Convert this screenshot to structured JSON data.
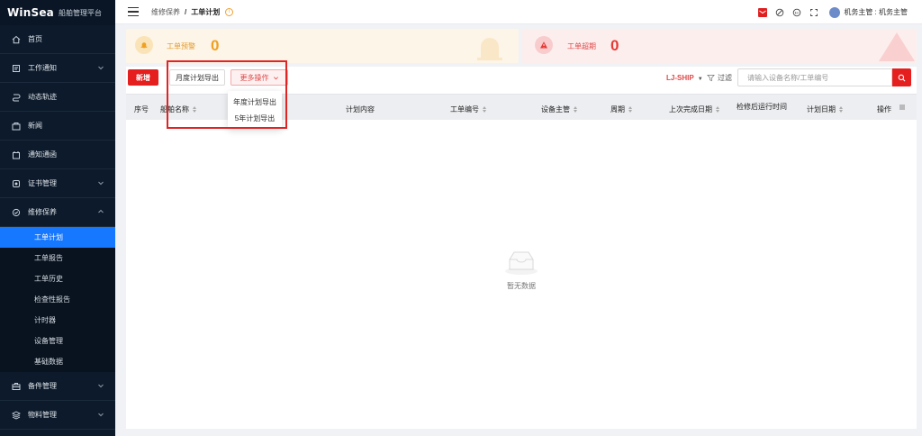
{
  "brand": {
    "logo": "WinSea",
    "subtitle": "船舶管理平台"
  },
  "sidebar": {
    "items": [
      {
        "label": "首页",
        "icon": "home-icon",
        "expandable": false
      },
      {
        "label": "工作通知",
        "icon": "notice-icon",
        "expandable": true
      },
      {
        "label": "动态轨迹",
        "icon": "track-icon",
        "expandable": false
      },
      {
        "label": "新闻",
        "icon": "news-icon",
        "expandable": false
      },
      {
        "label": "通知通函",
        "icon": "circular-icon",
        "expandable": false
      },
      {
        "label": "证书管理",
        "icon": "certificate-icon",
        "expandable": true
      },
      {
        "label": "维修保养",
        "icon": "maintenance-icon",
        "expandable": true,
        "expanded": true
      }
    ],
    "subitems": [
      {
        "label": "工单计划",
        "active": true
      },
      {
        "label": "工单报告"
      },
      {
        "label": "工单历史"
      },
      {
        "label": "检查性报告"
      },
      {
        "label": "计时器"
      },
      {
        "label": "设备管理"
      },
      {
        "label": "基础数据"
      }
    ],
    "bottom_items": [
      {
        "label": "备件管理",
        "icon": "spare-parts-icon",
        "expandable": true
      },
      {
        "label": "物料管理",
        "icon": "material-icon",
        "expandable": true
      }
    ]
  },
  "header": {
    "breadcrumb": {
      "parent": "维修保养",
      "separator": "/",
      "current": "工单计划"
    },
    "user": "机务主管 : 机务主管"
  },
  "alerts": {
    "warning": {
      "label": "工单预警",
      "count": "0"
    },
    "overdue": {
      "label": "工单超期",
      "count": "0"
    }
  },
  "toolbar": {
    "new_label": "新增",
    "month_export_label": "月度计划导出",
    "more_label": "更多操作",
    "ship": "LJ-SHIP",
    "filter_label": "过滤",
    "search_placeholder": "请输入设备名称/工单编号"
  },
  "dropdown": {
    "items": [
      "年度计划导出",
      "5年计划导出"
    ]
  },
  "table": {
    "columns": [
      "序号",
      "船舶名称",
      "计划内容",
      "工单编号",
      "设备主管",
      "周期",
      "上次完成日期",
      "检修后运行时间",
      "计划日期",
      "操作"
    ]
  },
  "empty_text": "暂无数据",
  "colors": {
    "sidebar_bg": "#0c1a2b",
    "accent": "#1677ff",
    "brand_red": "#e51e1e",
    "warning": "#f0a020",
    "danger": "#e53935"
  }
}
